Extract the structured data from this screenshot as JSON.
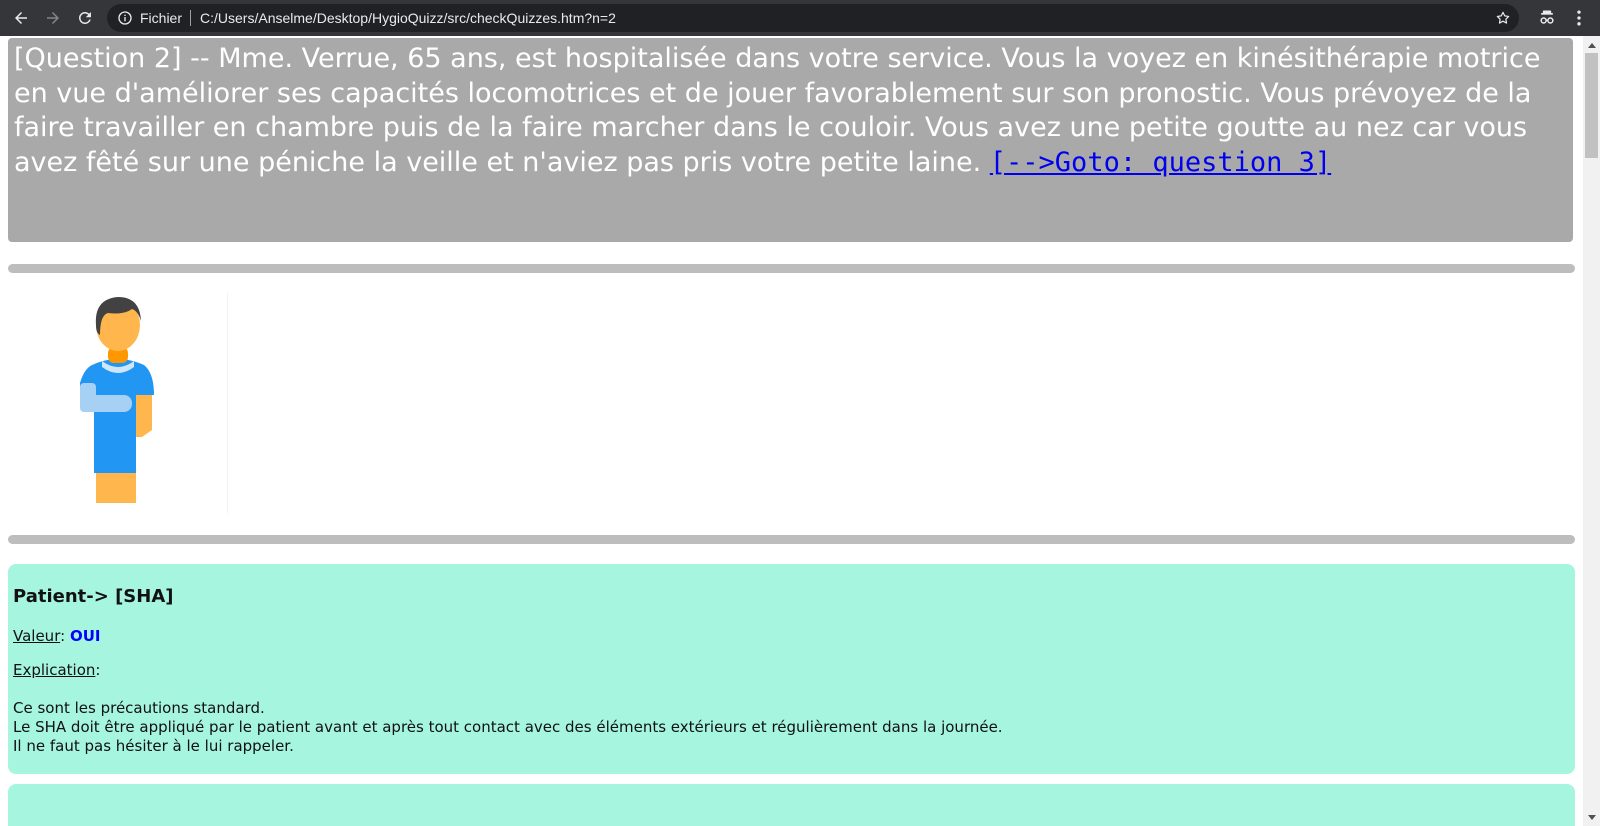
{
  "browser": {
    "scheme_label": "Fichier",
    "url": "C:/Users/Anselme/Desktop/HygioQuizz/src/checkQuizzes.htm?n=2"
  },
  "question": {
    "text": "[Question 2] -- Mme. Verrue, 65 ans, est hospitalisée dans votre service. Vous la voyez en kinésithérapie motrice en vue d'améliorer ses capacités locomotrices et de jouer favorablement sur son pronostic. Vous prévoyez de la faire travailler en chambre puis de la faire marcher dans le couloir. Vous avez une petite goutte au nez car vous avez fêté sur une péniche la veille et n'aviez pas pris votre petite laine. ",
    "goto_link": "[-->Goto: question 3]"
  },
  "answer": {
    "title": "Patient-> [SHA]",
    "value_label": "Valeur",
    "value_sep": ": ",
    "value": "OUI",
    "explication_label": "Explication",
    "explication_sep": ":",
    "explication_lines": [
      "Ce sont les précautions standard.",
      "Le SHA doit être appliqué par le patient avant et après tout contact avec des éléments extérieurs et régulièrement dans la journée.",
      "Il ne faut pas hésiter à le lui rappeler."
    ]
  },
  "colors": {
    "question_bg": "#a9a9a9",
    "answer_bg": "#a6f5df",
    "link": "#0000ee",
    "value": "#0000ff"
  }
}
